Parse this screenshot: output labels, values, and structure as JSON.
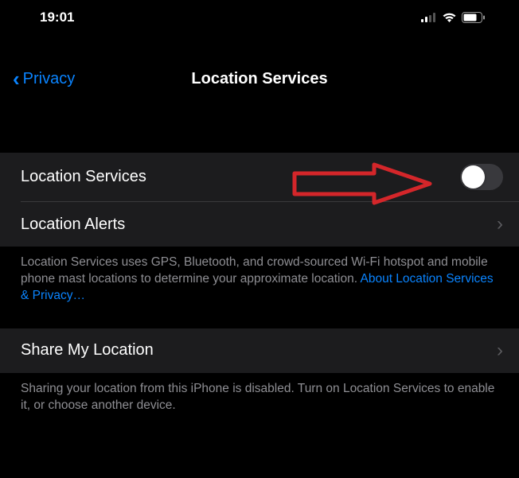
{
  "status": {
    "time": "19:01"
  },
  "nav": {
    "back_label": "Privacy",
    "title": "Location Services"
  },
  "rows": {
    "location_services": {
      "label": "Location Services"
    },
    "location_alerts": {
      "label": "Location Alerts"
    },
    "share_my_location": {
      "label": "Share My Location"
    }
  },
  "footers": {
    "services_desc": "Location Services uses GPS, Bluetooth, and crowd-sourced Wi-Fi hotspot and mobile phone mast locations to determine your approximate location. ",
    "services_link": "About Location Services & Privacy…",
    "share_desc": "Sharing your location from this iPhone is disabled. Turn on Location Services to enable it, or choose another device."
  }
}
